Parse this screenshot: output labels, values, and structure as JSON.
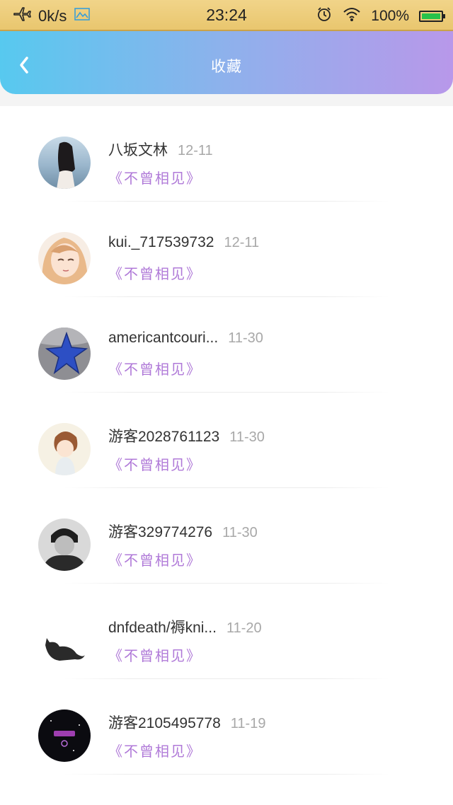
{
  "status_bar": {
    "speed": "0k/s",
    "time": "23:24",
    "battery": "100%",
    "battery_level": 1.0
  },
  "header": {
    "title": "收藏"
  },
  "items": [
    {
      "name": "八坂文林",
      "date": "12-11",
      "work": "《不曾相见》",
      "avatar_icon": "girl-back-photo"
    },
    {
      "name": "kui._717539732",
      "date": "12-11",
      "work": "《不曾相见》",
      "avatar_icon": "anime-girl"
    },
    {
      "name": "americantcouri...",
      "date": "11-30",
      "work": "《不曾相见》",
      "avatar_icon": "blue-star"
    },
    {
      "name": "游客2028761123",
      "date": "11-30",
      "work": "《不曾相见》",
      "avatar_icon": "cartoon-boy"
    },
    {
      "name": "游客329774276",
      "date": "11-30",
      "work": "《不曾相见》",
      "avatar_icon": "bw-portrait"
    },
    {
      "name": "dnfdeath/褥kni...",
      "date": "11-20",
      "work": "《不曾相见》",
      "avatar_icon": "black-cat"
    },
    {
      "name": "游客2105495778",
      "date": "11-19",
      "work": "《不曾相见》",
      "avatar_icon": "leo-constellation"
    }
  ]
}
